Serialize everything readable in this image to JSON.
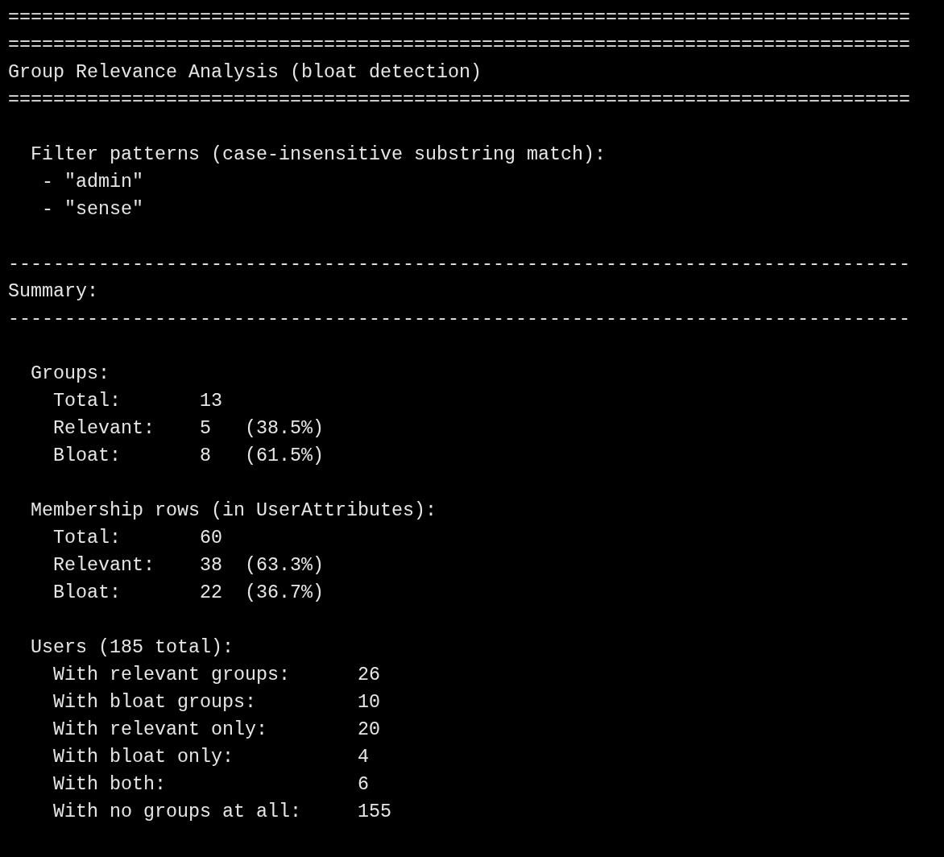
{
  "lines": [
    {
      "kind": "rule",
      "text": "================================================================================"
    },
    {
      "kind": "rule",
      "text": "================================================================================"
    },
    {
      "kind": "title",
      "text": "Group Relevance Analysis (bloat detection)"
    },
    {
      "kind": "rule",
      "text": "================================================================================"
    },
    {
      "kind": "blank"
    },
    {
      "kind": "heading",
      "text": "Filter patterns (case-insensitive substring match):"
    },
    {
      "kind": "bullet",
      "text": "- \"admin\""
    },
    {
      "kind": "bullet",
      "text": "- \"sense\""
    },
    {
      "kind": "blank"
    },
    {
      "kind": "rule",
      "text": "--------------------------------------------------------------------------------"
    },
    {
      "kind": "title",
      "text": "Summary:"
    },
    {
      "kind": "rule",
      "text": "--------------------------------------------------------------------------------"
    },
    {
      "kind": "blank"
    },
    {
      "kind": "heading",
      "text": "Groups:"
    },
    {
      "kind": "stat",
      "label": "Total:",
      "value": "13"
    },
    {
      "kind": "stat",
      "label": "Relevant:",
      "value": "5",
      "percent": "(38.5%)"
    },
    {
      "kind": "stat",
      "label": "Bloat:",
      "value": "8",
      "percent": "(61.5%)"
    },
    {
      "kind": "blank"
    },
    {
      "kind": "heading",
      "text": "Membership rows (in UserAttributes):"
    },
    {
      "kind": "stat",
      "label": "Total:",
      "value": "60"
    },
    {
      "kind": "stat",
      "label": "Relevant:",
      "value": "38",
      "percent": "(63.3%)"
    },
    {
      "kind": "stat",
      "label": "Bloat:",
      "value": "22",
      "percent": "(36.7%)"
    },
    {
      "kind": "blank"
    },
    {
      "kind": "heading",
      "text": "Users (185 total):"
    },
    {
      "kind": "count",
      "label": "With relevant groups:",
      "value": "26"
    },
    {
      "kind": "count",
      "label": "With bloat groups:",
      "value": "10"
    },
    {
      "kind": "count",
      "label": "With relevant only:",
      "value": "20"
    },
    {
      "kind": "count",
      "label": "With bloat only:",
      "value": "4"
    },
    {
      "kind": "count",
      "label": "With both:",
      "value": "6"
    },
    {
      "kind": "count",
      "label": "With no groups at all:",
      "value": "155"
    }
  ]
}
